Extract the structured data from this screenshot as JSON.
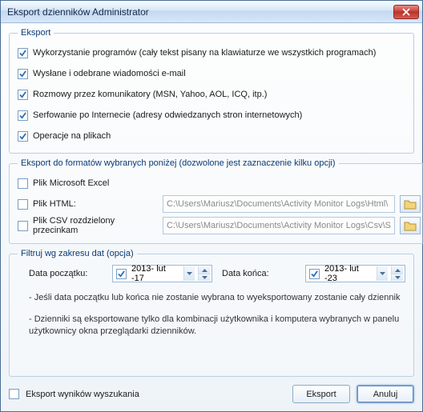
{
  "window": {
    "title": "Eksport dzienników Administrator"
  },
  "group_export": {
    "legend": "Eksport",
    "opt1": "Wykorzystanie programów  (cały tekst pisany na klawiaturze we wszystkich programach)",
    "opt2": "Wysłane i odebrane wiadomości e-mail",
    "opt3": "Rozmowy przez komunikatory  (MSN, Yahoo, AOL, ICQ, itp.)",
    "opt4": "Serfowanie po Internecie (adresy odwiedzanych stron internetowych)",
    "opt5": "Operacje na plikach"
  },
  "group_formats": {
    "legend": "Eksport do formatów wybranych poniżej  (dozwolone jest zaznaczenie kilku opcji)",
    "excel_label": "Plik Microsoft Excel",
    "html_label": "Plik HTML:",
    "html_path": "C:\\Users\\Mariusz\\Documents\\Activity Monitor Logs\\Html\\",
    "csv_label": "Plik CSV rozdzielony przecinkam",
    "csv_path": "C:\\Users\\Mariusz\\Documents\\Activity Monitor Logs\\Csv\\S"
  },
  "group_dates": {
    "legend": "Filtruj wg zakresu dat  (opcja)",
    "start_label": "Data początku:",
    "start_value": "2013- lut -17",
    "end_label": "Data końca:",
    "end_value": "2013- lut -23",
    "note1": "- Jeśli data początku lub końca nie zostanie wybrana to wyeksportowany zostanie cały dziennik",
    "note2": "- Dzienniki są eksportowane tylko dla kombinacji użytkownika i komputera wybranych w panelu użytkownicy okna przeglądarki dzienników."
  },
  "footer": {
    "export_results_label": "Eksport wyników wyszukania",
    "export_btn": "Eksport",
    "cancel_btn": "Anuluj"
  }
}
